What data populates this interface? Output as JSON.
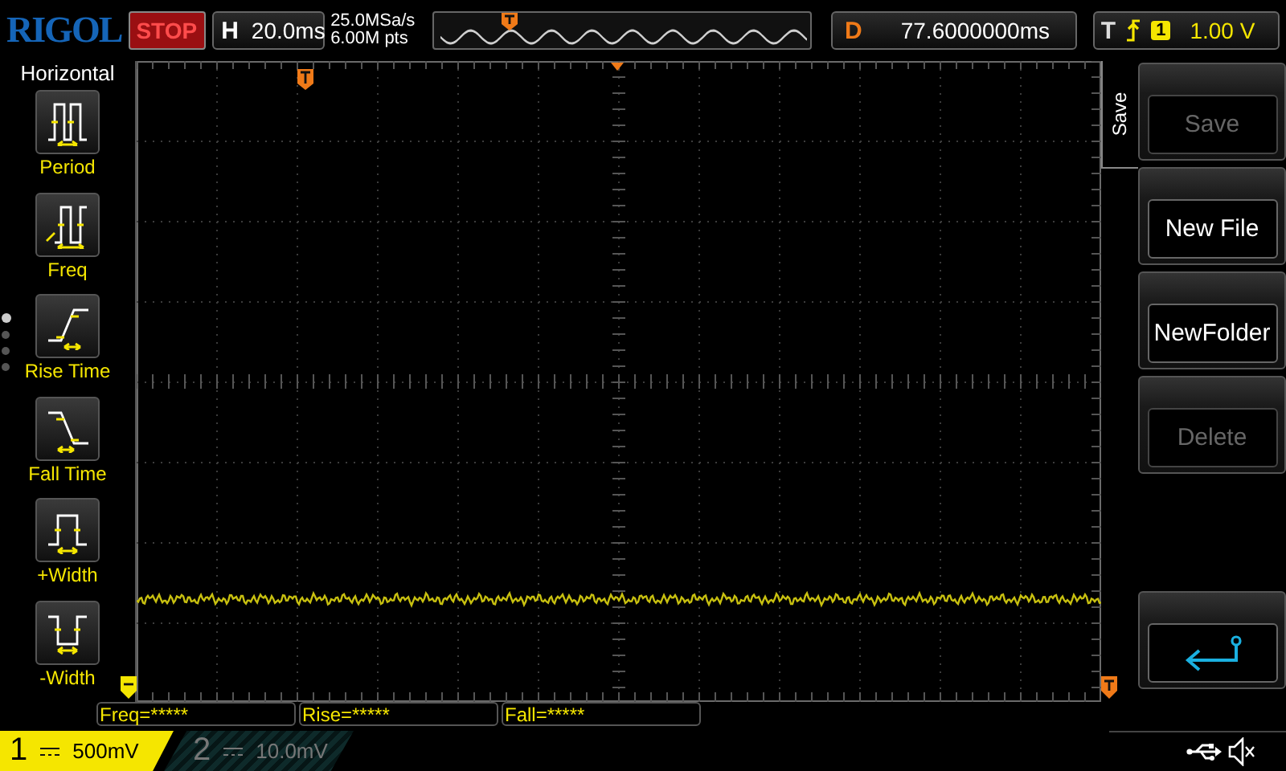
{
  "brand": "RIGOL",
  "run_state": {
    "label": "STOP",
    "stopped": true
  },
  "timebase": {
    "label": "H",
    "value": "20.0ms"
  },
  "sampling": {
    "rate": "25.0MSa/s",
    "points": "6.00M pts"
  },
  "delay": {
    "label": "D",
    "value": "77.6000000ms"
  },
  "trigger": {
    "label": "T",
    "channel": "1",
    "level": "1.00 V"
  },
  "left_menu": {
    "title": "Horizontal",
    "items": [
      {
        "label": "Period",
        "kind": "period"
      },
      {
        "label": "Freq",
        "kind": "freq"
      },
      {
        "label": "Rise Time",
        "kind": "rise"
      },
      {
        "label": "Fall Time",
        "kind": "fall"
      },
      {
        "label": "+Width",
        "kind": "pwidth"
      },
      {
        "label": "-Width",
        "kind": "nwidth"
      }
    ]
  },
  "right_menu": {
    "title": "Save",
    "buttons": [
      {
        "label": "Save",
        "kind": "text",
        "disabled": true
      },
      {
        "label": "New File",
        "kind": "text",
        "disabled": false
      },
      {
        "label": "NewFolder",
        "kind": "text",
        "disabled": false
      },
      {
        "label": "Delete",
        "kind": "text",
        "disabled": true
      },
      {
        "kind": "back",
        "disabled": false
      }
    ]
  },
  "measurements": [
    "Freq=*****",
    "Rise=*****",
    "Fall=*****"
  ],
  "channels": [
    {
      "number": "1",
      "scale": "500mV",
      "active": true
    },
    {
      "number": "2",
      "scale": "10.0mV",
      "active": false
    }
  ]
}
